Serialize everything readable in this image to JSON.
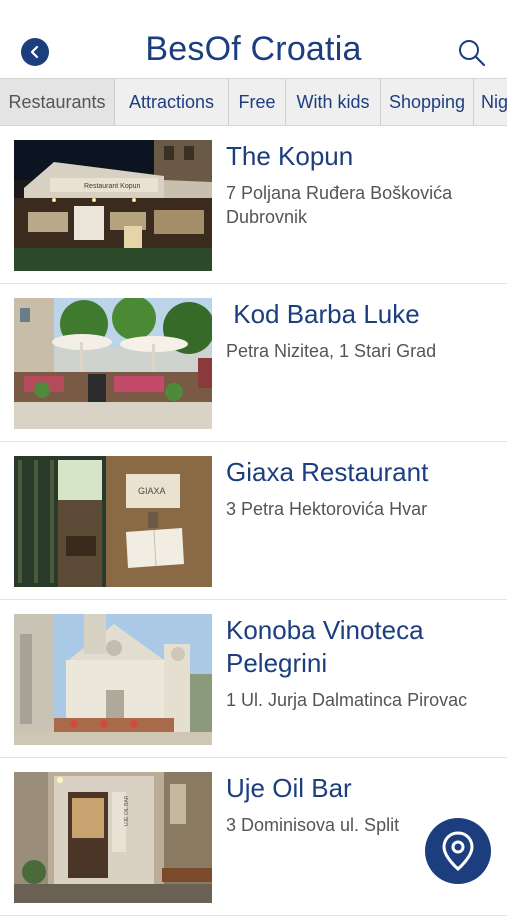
{
  "header": {
    "title": "BesOf Croatia",
    "back_icon": "back-arrow-icon",
    "search_icon": "search-icon"
  },
  "tabs": [
    {
      "label": "Restaurants",
      "active": true
    },
    {
      "label": "Attractions",
      "active": false
    },
    {
      "label": "Free",
      "active": false
    },
    {
      "label": "With kids",
      "active": false
    },
    {
      "label": "Shopping",
      "active": false
    },
    {
      "label": "Nig",
      "active": false
    }
  ],
  "places": [
    {
      "name": "The Kopun",
      "address": "7 Poljana Ruđera Boškovića Dubrovnik",
      "image": "restaurant-terrace-night-photo",
      "sign": "Restaurant Kopun"
    },
    {
      "name": " Kod Barba Luke",
      "address": "Petra Nizitea, 1 Stari Grad",
      "image": "terrace-with-umbrellas-photo"
    },
    {
      "name": "Giaxa Restaurant",
      "address": "3 Petra Hektorovića Hvar",
      "image": "stone-entrance-sign-photo",
      "sign": "GIAXA"
    },
    {
      "name": "Konoba Vinoteca Pelegrini",
      "address": "1 Ul. Jurja Dalmatinca Pirovac",
      "image": "cathedral-square-photo"
    },
    {
      "name": "Uje Oil Bar",
      "address": "3 Dominisova ul. Split",
      "image": "oil-bar-storefront-photo",
      "sign": "UJE OIL BAR"
    }
  ],
  "map_button_icon": "map-pin-icon",
  "colors": {
    "brand": "#1d3e7e",
    "tab_bg": "#ececec",
    "text_secondary": "#555555"
  }
}
